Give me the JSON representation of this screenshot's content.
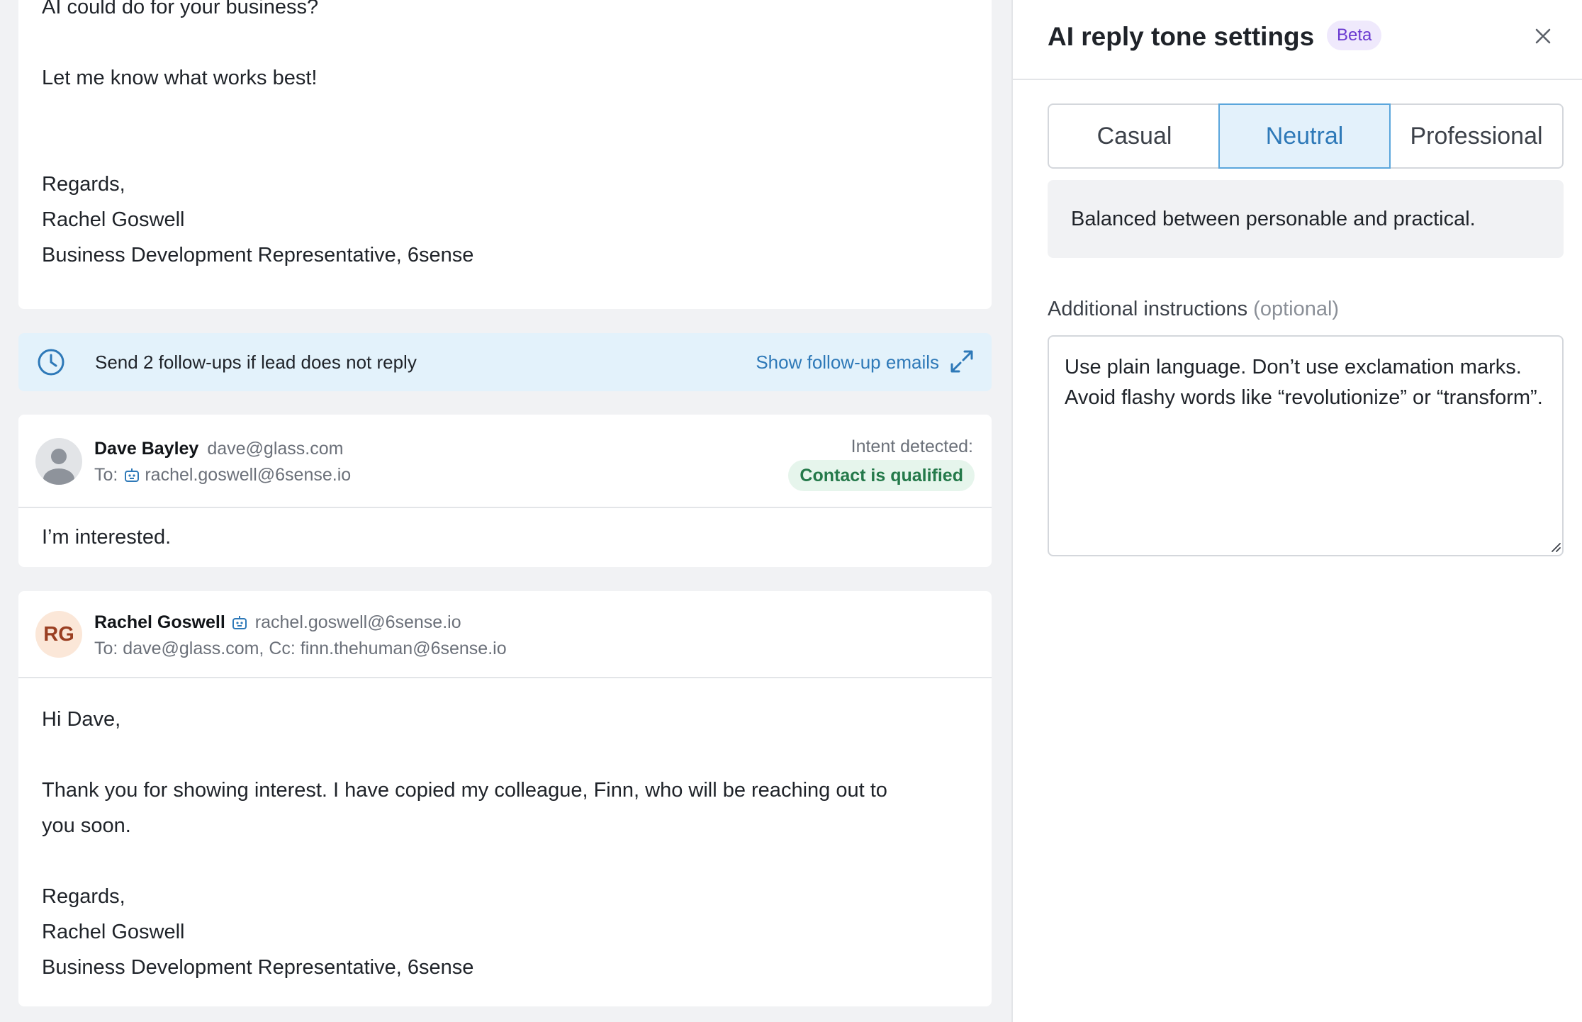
{
  "thread": {
    "intro_message": {
      "lines": [
        "AI could do for your  business?",
        "",
        "Let me know what works best!",
        "",
        "",
        "Regards,",
        "Rachel Goswell",
        "Business Development Representative, 6sense"
      ]
    },
    "followup_banner": {
      "icon": "clock-icon",
      "text": "Send 2 follow-ups if lead does not reply",
      "link": "Show follow-up emails",
      "link_icon": "expand-icon"
    },
    "reply_message": {
      "sender_name": "Dave Bayley",
      "sender_email": "dave@glass.com",
      "to_prefix": "To:",
      "to_email": "rachel.goswell@6sense.io",
      "intent_label": "Intent detected:",
      "intent_value": "Contact is qualified",
      "body": [
        "I’m interested."
      ]
    },
    "response_message": {
      "avatar_initials": "RG",
      "sender_name": "Rachel Goswell",
      "sender_email": "rachel.goswell@6sense.io",
      "to_line": "To: dave@glass.com, Cc: finn.thehuman@6sense.io",
      "body": [
        "Hi Dave,",
        "",
        "Thank you for showing interest. I have copied my colleague, Finn, who will be reaching out to",
        "you soon.",
        "",
        "Regards,",
        "Rachel Goswell",
        "Business Development Representative, 6sense"
      ]
    }
  },
  "panel": {
    "title": "AI reply tone settings",
    "badge": "Beta",
    "close_icon": "close-icon",
    "tones": [
      "Casual",
      "Neutral",
      "Professional"
    ],
    "selected_tone": "Neutral",
    "tone_description": "Balanced between personable and practical.",
    "instructions_label": "Additional instructions",
    "instructions_optional": "(optional)",
    "instructions_value": "Use plain language. Don’t use exclamation marks. Avoid flashy words like “revolutionize” or “transform”."
  },
  "colors": {
    "accent": "#2e79b8",
    "selected_bg": "#e3f1fb",
    "banner_bg": "#e3f2fb",
    "success_text": "#24794a",
    "success_bg": "#e6f5ec",
    "beta_text": "#6a3ad0",
    "beta_bg": "#efe9fc",
    "page_bg": "#f1f2f4"
  }
}
